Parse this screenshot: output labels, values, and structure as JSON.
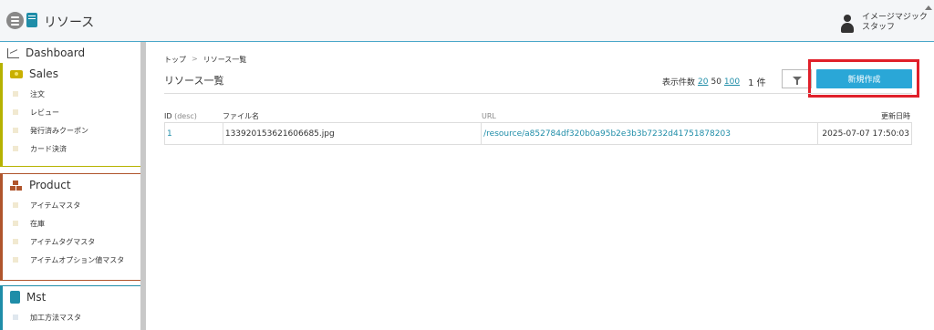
{
  "header": {
    "app_title": "リソース",
    "user_name_line1": "イメージマジック",
    "user_name_line2": "スタッフ"
  },
  "sidebar": {
    "dashboard": {
      "label": "Dashboard",
      "icon": "chart-icon"
    },
    "sales": {
      "label": "Sales",
      "icon": "money-icon",
      "items": [
        "注文",
        "レビュー",
        "発行済みクーポン",
        "カード決済"
      ]
    },
    "product": {
      "label": "Product",
      "icon": "boxes-icon",
      "items": [
        "アイテムマスタ",
        "在庫",
        "アイテムタグマスタ",
        "アイテムオプション値マスタ"
      ]
    },
    "mst": {
      "label": "Mst",
      "icon": "book-icon",
      "items": [
        "加工方法マスタ"
      ]
    }
  },
  "main": {
    "breadcrumb": {
      "home": "トップ",
      "separator": ">",
      "current": "リソース一覧"
    },
    "page_title": "リソース一覧",
    "count_info": {
      "label": "表示件数",
      "options": [
        "20",
        "50",
        "100"
      ],
      "total": "1 件"
    },
    "new_button_label": "新規作成",
    "table": {
      "headers": {
        "id": "ID",
        "id_sort": "(desc)",
        "file_name": "ファイル名",
        "url": "URL",
        "updated": "更新日時"
      },
      "rows": [
        {
          "id": "1",
          "file_name": "133920153621606685.jpg",
          "url": "/resource/a852784df320b0a95b2e3b3b7232d41751878203",
          "updated": "2025-07-07 17:50:03"
        }
      ]
    }
  },
  "colors": {
    "accent": "#2aa7d7",
    "link": "#1f8da8",
    "sales": "#b6b200",
    "product": "#b0552c",
    "mst": "#1f8da8",
    "highlight": "#e0202a"
  }
}
